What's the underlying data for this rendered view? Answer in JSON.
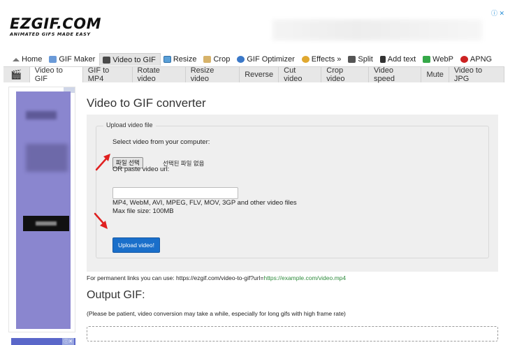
{
  "logo": {
    "name": "EZGIF.COM",
    "tagline": "ANIMATED GIFS MADE EASY"
  },
  "ad_top": {
    "choice": "ⓘ ✕"
  },
  "main_nav": [
    {
      "label": "Home",
      "icon": "home-icon"
    },
    {
      "label": "GIF Maker",
      "icon": "gif-maker-icon"
    },
    {
      "label": "Video to GIF",
      "icon": "video-icon",
      "active": true
    },
    {
      "label": "Resize",
      "icon": "resize-icon"
    },
    {
      "label": "Crop",
      "icon": "crop-icon"
    },
    {
      "label": "GIF Optimizer",
      "icon": "optimizer-icon"
    },
    {
      "label": "Effects »",
      "icon": "effects-icon"
    },
    {
      "label": "Split",
      "icon": "split-icon"
    },
    {
      "label": "Add text",
      "icon": "text-icon"
    },
    {
      "label": "WebP",
      "icon": "webp-icon"
    },
    {
      "label": "APNG",
      "icon": "apng-icon"
    }
  ],
  "sub_nav": [
    {
      "label": "Video to GIF",
      "active": true
    },
    {
      "label": "GIF to MP4"
    },
    {
      "label": "Rotate video"
    },
    {
      "label": "Resize video"
    },
    {
      "label": "Reverse"
    },
    {
      "label": "Cut video"
    },
    {
      "label": "Crop video"
    },
    {
      "label": "Video speed"
    },
    {
      "label": "Mute"
    },
    {
      "label": "Video to JPG"
    }
  ],
  "page": {
    "title": "Video to GIF converter",
    "upload": {
      "legend": "Upload video file",
      "select_label": "Select video from your computer:",
      "file_button": "파일 선택",
      "file_status": "선택된 파일 없음",
      "url_label": "OR paste video url:",
      "url_value": "",
      "formats": "MP4, WebM, AVI, MPEG, FLV, MOV, 3GP and other video files",
      "max_size": "Max file size: 100MB",
      "upload_button": "Upload video!"
    },
    "permanent_prefix": "For permanent links you can use: https://ezgif.com/video-to-gif?url=",
    "permanent_link": "https://example.com/video.mp4",
    "output_title": "Output GIF:",
    "output_note": "(Please be patient, video conversion may take a while, especially for long gifs with high frame rate)"
  },
  "colors": {
    "accent": "#1a6fca",
    "arrow": "#e02020",
    "link": "#2e8b3c",
    "ad_bg": "#8a86cf"
  }
}
